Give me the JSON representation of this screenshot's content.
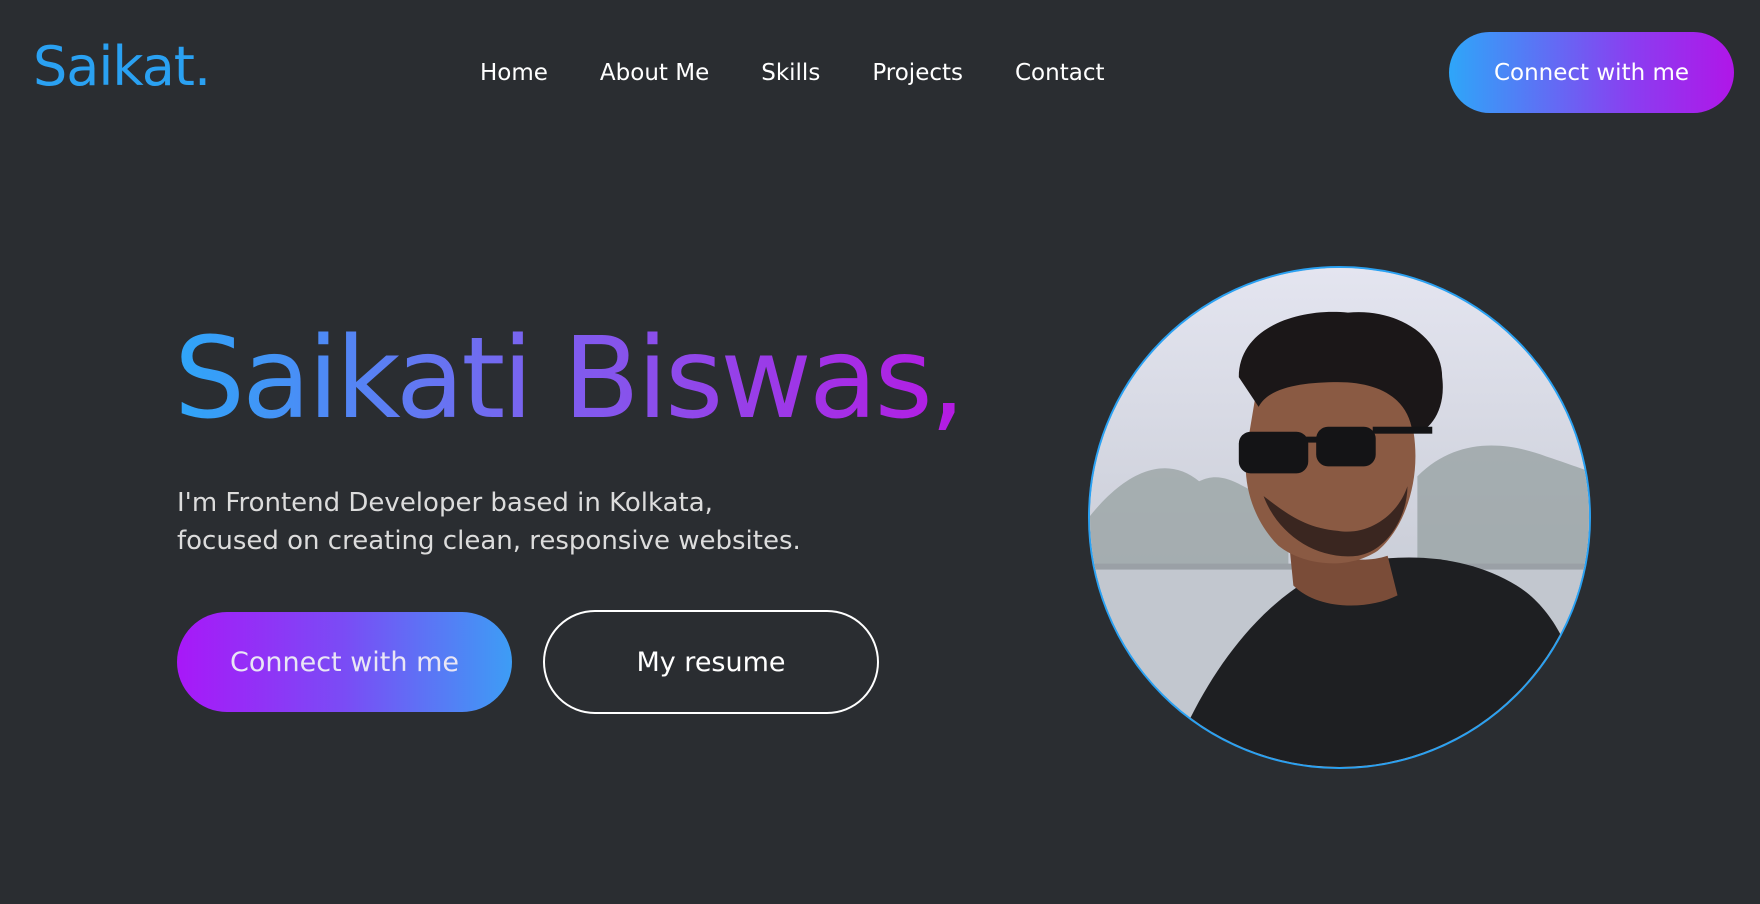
{
  "header": {
    "logo": "Saikat.",
    "nav": [
      "Home",
      "About Me",
      "Skills",
      "Projects",
      "Contact"
    ],
    "cta_label": "Connect with me"
  },
  "hero": {
    "title": "Saikati Biswas,",
    "description_lines": [
      "I'm Frontend Developer based in Kolkata,",
      "focused on creating clean, responsive websites."
    ],
    "primary_button": "Connect with me",
    "secondary_button": "My resume"
  },
  "colors": {
    "background": "#2a2d31",
    "accent_blue": "#2aa1f2",
    "accent_purple": "#b016e8"
  }
}
